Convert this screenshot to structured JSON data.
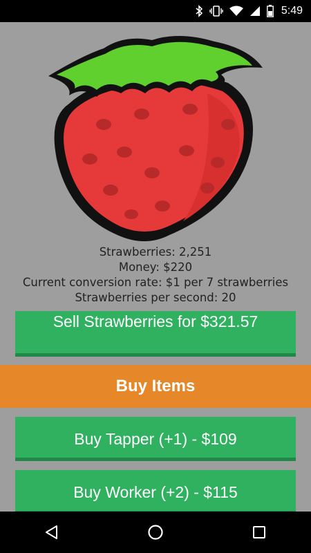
{
  "status_bar": {
    "time": "5:49",
    "icons": [
      "bluetooth-icon",
      "vibrate-icon",
      "wifi-icon",
      "signal-icon",
      "battery-icon"
    ]
  },
  "game": {
    "image": "strawberry-image",
    "stats": {
      "strawberries": "Strawberries: 2,251",
      "money": "Money: $220",
      "conversion_rate": "Current conversion rate: $1 per 7 strawberries",
      "per_second": "Strawberries per second: 20"
    },
    "sell_button": "Sell Strawberries for $321.57",
    "buy_items_header": "Buy Items",
    "buy_tapper_button": "Buy Tapper (+1) - $109",
    "buy_worker_button": "Buy Worker (+2) - $115"
  },
  "nav_bar": {
    "icons": [
      "back-icon",
      "home-icon",
      "recents-icon"
    ]
  },
  "colors": {
    "background": "#9e9e9e",
    "button_green": "#2fb160",
    "header_orange": "#e6882a",
    "berry_red": "#e63a3a",
    "leaf_green": "#5fd02e"
  }
}
